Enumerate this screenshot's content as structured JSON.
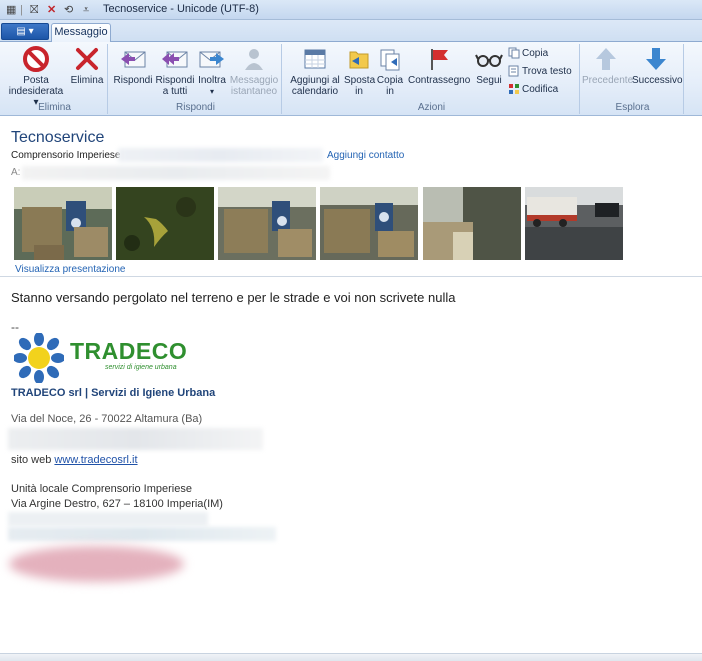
{
  "window": {
    "title": "Tecnoservice - Unicode (UTF-8)"
  },
  "tabs": {
    "file_glyph": "▤ ▾",
    "message": "Messaggio"
  },
  "ribbon": {
    "elimina_group": {
      "label": "Elimina",
      "junk": "Posta\nindesiderata",
      "delete": "Elimina"
    },
    "rispondi_group": {
      "label": "Rispondi",
      "reply": "Rispondi",
      "reply_all": "Rispondi\na tutti",
      "forward": "Inoltra",
      "im": "Messaggio\nistantaneo"
    },
    "azioni_group": {
      "label": "Azioni",
      "calendar": "Aggiungi al\ncalendario",
      "move": "Sposta\nin",
      "copy_to": "Copia\nin",
      "flag": "Contrassegno",
      "follow": "Segui",
      "copy": "Copia",
      "find": "Trova testo",
      "encoding": "Codifica"
    },
    "esplora_group": {
      "label": "Esplora",
      "prev": "Precedente",
      "next": "Successivo"
    }
  },
  "header": {
    "title": "Tecnoservice",
    "from_org": "Comprensorio Imperiese",
    "add_contact": "Aggiungi contatto",
    "to_label": "A:"
  },
  "attachments": {
    "slideshow": "Visualizza presentazione"
  },
  "message": {
    "body": "Stanno versando pergolato nel terreno e per le strade e voi non scrivete nulla",
    "sig_dash": "--",
    "logo_name": "TRADECO",
    "logo_tagline": "servizi di igiene urbana",
    "company": "TRADECO srl | Servizi di Igiene Urbana",
    "address": "Via del Noce, 26 - 70022 Altamura (Ba)",
    "web_label": "sito web",
    "web_link": "www.tradecosrl.it",
    "local_unit": "Unità locale Comprensorio Imperiese",
    "local_address": "Via Argine Destro, 627 – 18100  Imperia(IM)"
  },
  "colors": {
    "accent": "#21457a",
    "link": "#2464b4",
    "logo_green": "#2f8f2f",
    "logo_sun": "#2f6bb8"
  }
}
